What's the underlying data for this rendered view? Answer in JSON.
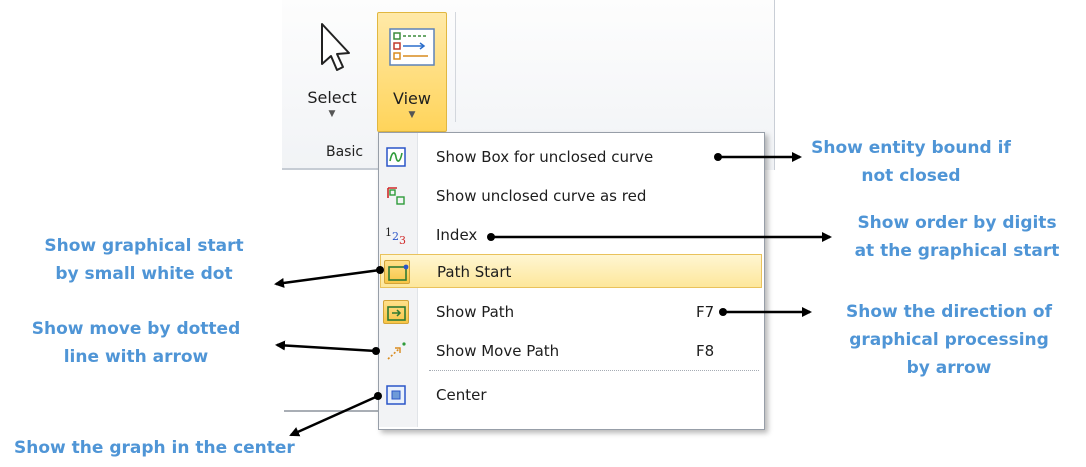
{
  "ribbon": {
    "select_label": "Select",
    "view_label": "View",
    "group_label": "Basic",
    "select_icon": "cursor-arrow-icon",
    "view_icon": "view-list-icon"
  },
  "menu": {
    "items": [
      {
        "label": "Show Box for unclosed curve",
        "shortcut": "",
        "icon": "box-curve-icon"
      },
      {
        "label": "Show unclosed curve as red",
        "shortcut": "",
        "icon": "red-curve-icon"
      },
      {
        "label": "Index",
        "shortcut": "",
        "icon": "index-digits-icon"
      },
      {
        "label": "Path Start",
        "shortcut": "",
        "icon": "path-start-icon"
      },
      {
        "label": "Show Path",
        "shortcut": "F7",
        "icon": "show-path-icon"
      },
      {
        "label": "Show Move Path",
        "shortcut": "F8",
        "icon": "move-path-icon"
      },
      {
        "label": "Center",
        "shortcut": "",
        "icon": "center-icon"
      }
    ],
    "highlighted_index": 3
  },
  "annotations": {
    "entity_bound": [
      "Show entity bound if",
      "not closed"
    ],
    "order_digits": [
      "Show order by digits",
      "at the graphical start"
    ],
    "graphical_start": [
      "Show graphical start",
      "by small white dot"
    ],
    "direction": [
      "Show the direction of",
      "graphical processing",
      "by arrow"
    ],
    "move_dotted": [
      "Show move by dotted",
      "line with arrow"
    ],
    "graph_center": [
      "Show the graph in the center"
    ]
  },
  "colors": {
    "annotation": "#4f95d6",
    "highlight": "#fde79b",
    "arrow": "#000000"
  }
}
